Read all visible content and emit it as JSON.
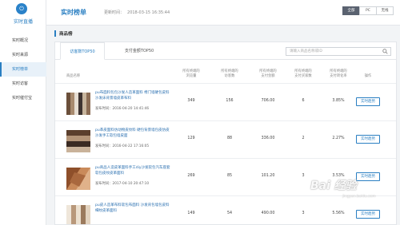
{
  "sidebar": {
    "brand": "实时直播",
    "items": [
      {
        "label": "实时概况"
      },
      {
        "label": "实时来源"
      },
      {
        "label": "实时榜单"
      },
      {
        "label": "实时访客"
      },
      {
        "label": "实时催付宝"
      }
    ],
    "active_index": 2
  },
  "header": {
    "title": "实时榜单",
    "update_label": "更新时间：",
    "update_time": "2018-03-15 16:35:44",
    "device_tabs": [
      {
        "label": "全部"
      },
      {
        "label": "PC"
      },
      {
        "label": "无线"
      }
    ],
    "active_device": 0
  },
  "section": {
    "title": "商品榜"
  },
  "panel": {
    "tabs": [
      {
        "label": "访客数TOP50"
      },
      {
        "label": "支付金额TOP50"
      }
    ],
    "active_tab": 0,
    "search_placeholder": "请输入商品名称或ID"
  },
  "table": {
    "headers": {
      "product": "商品名称",
      "browse": [
        "所有终端的",
        "浏览量"
      ],
      "visitors": [
        "所有终端的",
        "访客数"
      ],
      "pay_amount": [
        "所有终端的",
        "支付金额"
      ],
      "buyers": [
        "所有终端的",
        "支付买家数"
      ],
      "conversion": [
        "所有终端的",
        "支付转化率"
      ],
      "action": "操作"
    },
    "rows": [
      {
        "name": "pu布面料包包沙发人造革面料 椅门墙硬包皮料沙发床背景墙皮革布料",
        "published": "发布时间：2016-04-20 14:41:46",
        "browse": "349",
        "visitors": "156",
        "pay_amount": "706.00",
        "buyers": "6",
        "conversion": "3.85%",
        "action": "实时趋势"
      },
      {
        "name": "pu革皮面料仿动物皮纹料 硬包背景墙包皮仿皮沙发手工软包墙皮面",
        "published": "发布时间：2016-04-22 17:16:05",
        "browse": "129",
        "visitors": "88",
        "pay_amount": "336.00",
        "buyers": "2",
        "conversion": "2.27%",
        "action": "实时趋势"
      },
      {
        "name": "pu商品人造皮革面料手工diy沙发软包汽车座套软包皮纹皮革面料",
        "published": "发布时间：2017-04-10 20:47:10",
        "browse": "269",
        "visitors": "85",
        "pay_amount": "101.20",
        "buyers": "3",
        "conversion": "3.53%",
        "action": "实时趋势"
      },
      {
        "name": "pu皮人造革布料软包布面料 沙发背包墙包皮料细纹皮革面料",
        "published": "",
        "browse": "149",
        "visitors": "54",
        "pay_amount": "490.00",
        "buyers": "3",
        "conversion": "5.56%",
        "action": "实时趋势"
      }
    ]
  },
  "watermark": {
    "logo": "Bai 经验",
    "url": "jingyan.baidu.com"
  },
  "colors": {
    "accent": "#2a7fc2",
    "logo": "#2a82c9"
  }
}
